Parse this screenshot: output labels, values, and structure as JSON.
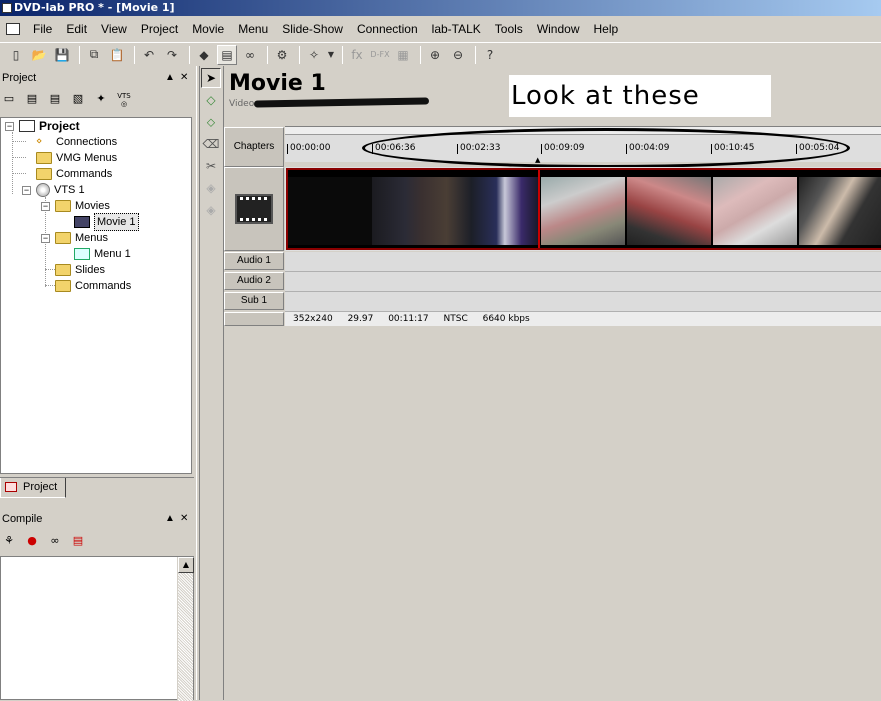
{
  "window": {
    "title": "DVD-lab PRO * - [Movie 1]"
  },
  "menu": [
    "File",
    "Edit",
    "View",
    "Project",
    "Movie",
    "Menu",
    "Slide-Show",
    "Connection",
    "lab-TALK",
    "Tools",
    "Window",
    "Help"
  ],
  "toolbar_icons": [
    "new-icon",
    "open-icon",
    "save-icon",
    "copy-icon",
    "paste-icon",
    "undo-icon",
    "redo-icon",
    "connect-icon",
    "assets-icon",
    "binoculars-icon",
    "compile-icon",
    "magic-wand-icon",
    "dropdown-icon",
    "fx-icon",
    "dfx-icon",
    "clapper-icon",
    "zoom-in-icon",
    "zoom-out-icon",
    "help-icon"
  ],
  "project_panel": {
    "title": "Project",
    "tree": [
      {
        "label": "Project",
        "level": 0,
        "icon": "project-icon",
        "bold": true
      },
      {
        "label": "Connections",
        "level": 1,
        "icon": "connections-icon"
      },
      {
        "label": "VMG Menus",
        "level": 1,
        "icon": "folder-icon"
      },
      {
        "label": "Commands",
        "level": 1,
        "icon": "folder-icon"
      },
      {
        "label": "VTS 1",
        "level": 1,
        "icon": "disc-icon"
      },
      {
        "label": "Movies",
        "level": 2,
        "icon": "folder-icon"
      },
      {
        "label": "Movie 1",
        "level": 3,
        "icon": "movie-icon",
        "selected": true
      },
      {
        "label": "Menus",
        "level": 2,
        "icon": "folder-icon"
      },
      {
        "label": "Menu 1",
        "level": 3,
        "icon": "menu-icon"
      },
      {
        "label": "Slides",
        "level": 2,
        "icon": "folder-icon"
      },
      {
        "label": "Commands",
        "level": 2,
        "icon": "folder-icon"
      }
    ],
    "tab_label": "Project",
    "vts_label": "VTS"
  },
  "compile_panel": {
    "title": "Compile"
  },
  "movie": {
    "title": "Movie 1",
    "video_label": "Video:",
    "annotation": "Look at these times",
    "rows": {
      "chapters": "Chapters",
      "audio1": "Audio 1",
      "audio2": "Audio 2",
      "sub1": "Sub 1"
    },
    "chapter_times": [
      "00:00:00",
      "00:06:36",
      "00:02:33",
      "00:09:09",
      "00:04:09",
      "00:10:45",
      "00:05:04"
    ],
    "status": {
      "resolution": "352x240",
      "fps": "29.97",
      "duration": "00:11:17",
      "standard": "NTSC",
      "bitrate": "6640 kbps"
    }
  },
  "colors": {
    "title_start": "#0a246a",
    "title_end": "#a6caf0",
    "strip_border": "#8a0000",
    "folder": "#f2d36b"
  }
}
